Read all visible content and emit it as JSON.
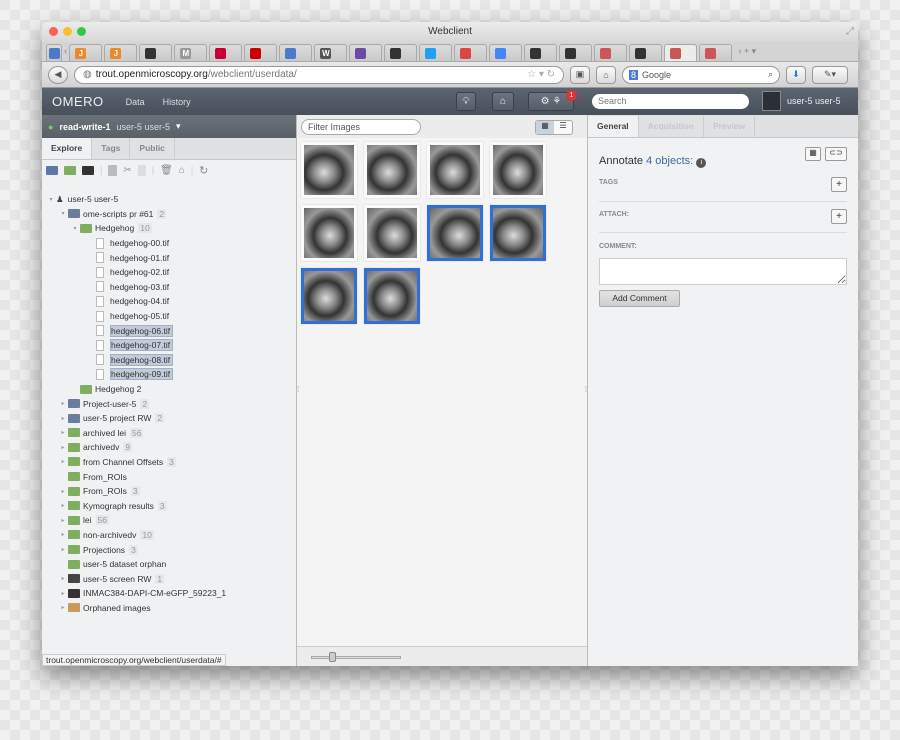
{
  "browser": {
    "title": "Webclient",
    "url_host": "trout.openmicroscopy.org",
    "url_path": "/webclient/userdata/",
    "search_engine": "Google",
    "tabs": [
      {
        "icon": "J",
        "color": "#e8892c"
      },
      {
        "icon": "J",
        "color": "#e8892c"
      },
      {
        "icon": "github",
        "color": "#333"
      },
      {
        "icon": "M",
        "color": "#999"
      },
      {
        "icon": "debian",
        "color": "#c70036"
      },
      {
        "icon": "redhat",
        "color": "#c00"
      },
      {
        "icon": "doc",
        "color": "#4a7bc8"
      },
      {
        "icon": "W",
        "color": "#555"
      },
      {
        "icon": "trello",
        "color": "#6a4ca5"
      },
      {
        "icon": "github",
        "color": "#333"
      },
      {
        "icon": "twitter",
        "color": "#1da1f2"
      },
      {
        "icon": "gmail 60+",
        "color": "#d44"
      },
      {
        "icon": "docs",
        "color": "#4285f4"
      },
      {
        "icon": "github",
        "color": "#333"
      },
      {
        "icon": "github",
        "color": "#333"
      },
      {
        "icon": "omero",
        "color": "#c55"
      },
      {
        "icon": "github",
        "color": "#333"
      },
      {
        "icon": "omero",
        "color": "#c55"
      },
      {
        "icon": "omero",
        "color": "#c55"
      }
    ]
  },
  "omero": {
    "logo": "OMERO",
    "nav": [
      "Data",
      "History"
    ],
    "notification_count": "1",
    "search_placeholder": "Search",
    "user": "user-5 user-5"
  },
  "left": {
    "group": "read-write-1",
    "group_user": "user-5 user-5",
    "tabs": [
      "Explore",
      "Tags",
      "Public"
    ],
    "tree": [
      {
        "label": "user-5 user-5",
        "type": "user",
        "level": 0,
        "arrow": "▾"
      },
      {
        "label": "ome-scripts pr #61",
        "count": "2",
        "type": "project",
        "level": 1,
        "arrow": "▾"
      },
      {
        "label": "Hedgehog",
        "count": "10",
        "type": "dataset",
        "level": 2,
        "arrow": "▾"
      },
      {
        "label": "hedgehog-00.tif",
        "type": "image",
        "level": 3
      },
      {
        "label": "hedgehog-01.tif",
        "type": "image",
        "level": 3
      },
      {
        "label": "hedgehog-02.tif",
        "type": "image",
        "level": 3
      },
      {
        "label": "hedgehog-03.tif",
        "type": "image",
        "level": 3
      },
      {
        "label": "hedgehog-04.tif",
        "type": "image",
        "level": 3
      },
      {
        "label": "hedgehog-05.tif",
        "type": "image",
        "level": 3
      },
      {
        "label": "hedgehog-06.tif",
        "type": "image",
        "level": 3,
        "selected": true
      },
      {
        "label": "hedgehog-07.tif",
        "type": "image",
        "level": 3,
        "selected": true
      },
      {
        "label": "hedgehog-08.tif",
        "type": "image",
        "level": 3,
        "selected": true
      },
      {
        "label": "hedgehog-09.tif",
        "type": "image",
        "level": 3,
        "selected": true
      },
      {
        "label": "Hedgehog 2",
        "type": "dataset",
        "level": 2
      },
      {
        "label": "Project-user-5",
        "count": "2",
        "type": "project",
        "level": 1,
        "arrow": "▸"
      },
      {
        "label": "user-5 project RW",
        "count": "2",
        "type": "project",
        "level": 1,
        "arrow": "▸"
      },
      {
        "label": "archived lei",
        "count": "56",
        "type": "dataset",
        "level": 1,
        "arrow": "▸"
      },
      {
        "label": "archivedv",
        "count": "9",
        "type": "dataset",
        "level": 1,
        "arrow": "▸"
      },
      {
        "label": "from Channel Offsets",
        "count": "3",
        "type": "dataset",
        "level": 1,
        "arrow": "▸"
      },
      {
        "label": "From_ROIs",
        "type": "dataset",
        "level": 1
      },
      {
        "label": "From_ROIs",
        "count": "3",
        "type": "dataset",
        "level": 1,
        "arrow": "▸"
      },
      {
        "label": "Kymograph results",
        "count": "3",
        "type": "dataset",
        "level": 1,
        "arrow": "▸"
      },
      {
        "label": "lei",
        "count": "56",
        "type": "dataset",
        "level": 1,
        "arrow": "▸"
      },
      {
        "label": "non-archivedv",
        "count": "10",
        "type": "dataset",
        "level": 1,
        "arrow": "▸"
      },
      {
        "label": "Projections",
        "count": "3",
        "type": "dataset",
        "level": 1,
        "arrow": "▸"
      },
      {
        "label": "user-5 dataset orphan",
        "type": "dataset",
        "level": 1
      },
      {
        "label": "user-5 screen RW",
        "count": "1",
        "type": "screen",
        "level": 1,
        "arrow": "▸"
      },
      {
        "label": "INMAC384-DAPI-CM-eGFP_59223_1",
        "type": "plate",
        "level": 1,
        "arrow": "▸"
      },
      {
        "label": "Orphaned images",
        "type": "orphaned",
        "level": 1,
        "arrow": "▸"
      }
    ],
    "status_url": "trout.openmicroscopy.org/webclient/userdata/#"
  },
  "center": {
    "filter_placeholder": "Filter Images",
    "thumbnails": [
      {
        "selected": false
      },
      {
        "selected": false
      },
      {
        "selected": false
      },
      {
        "selected": false
      },
      {
        "selected": false
      },
      {
        "selected": false
      },
      {
        "selected": true
      },
      {
        "selected": true
      },
      {
        "selected": true
      },
      {
        "selected": true
      }
    ],
    "zoom_slider": 0.2
  },
  "right": {
    "tabs": [
      "General",
      "Acquisition",
      "Preview"
    ],
    "annotate_prefix": "Annotate ",
    "annotate_link": "4 objects:",
    "tags_label": "TAGS",
    "attach_label": "ATTACH:",
    "comment_label": "COMMENT:",
    "comment_value": "",
    "add_comment": "Add Comment"
  },
  "colors": {
    "selection": "#2f6fd6",
    "header": "#4c5560",
    "project": "#6a7d9c",
    "dataset": "#7fae5e"
  }
}
